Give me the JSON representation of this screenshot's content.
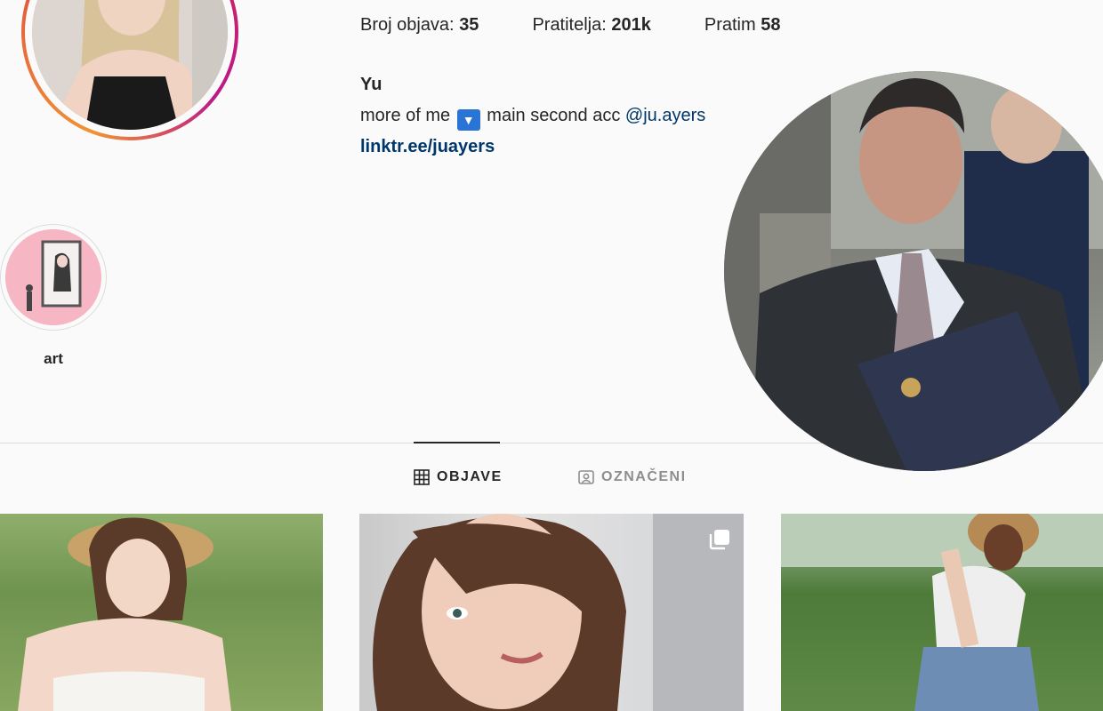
{
  "profile": {
    "stats": [
      {
        "label": "Broj objava:",
        "value": "35"
      },
      {
        "label": "Pratitelja:",
        "value": "201k"
      },
      {
        "label": "Pratim",
        "value": "58"
      }
    ],
    "name": "Yu",
    "bio_prefix": "more of me",
    "bio_emoji": "▼",
    "bio_middle": "main second acc",
    "bio_mention": "@ju.ayers",
    "website": "linktr.ee/juayers"
  },
  "highlights": [
    {
      "label": "art"
    }
  ],
  "tabs": [
    {
      "label": "OBJAVE",
      "icon": "grid-icon",
      "active": true
    },
    {
      "label": "OZNAČENI",
      "icon": "tagged-icon",
      "active": false
    }
  ],
  "colors": {
    "accent_link": "#00376b",
    "divider": "#dbdbdb",
    "inactive_tab": "#8e8e8e"
  }
}
